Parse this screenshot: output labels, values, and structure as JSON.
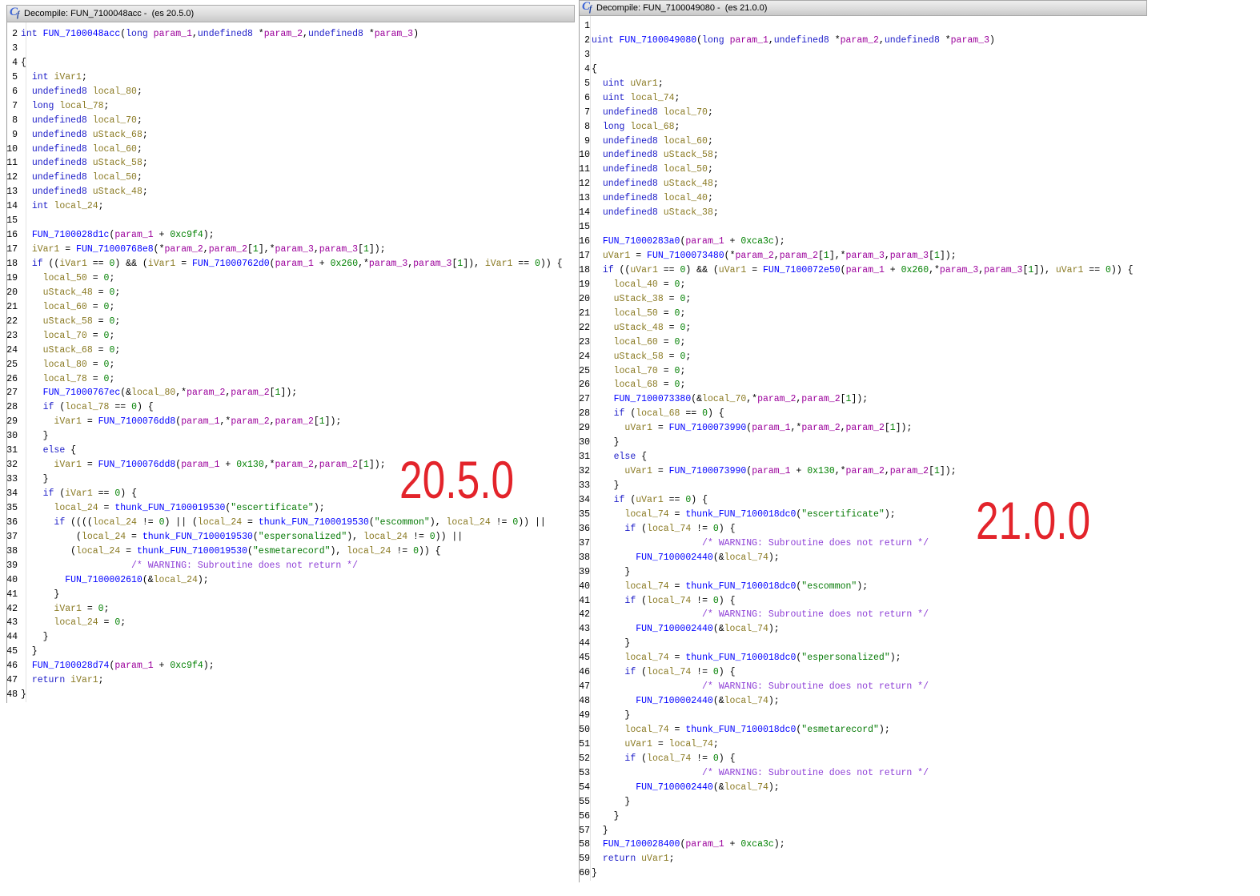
{
  "syntax_colors": {
    "keyword": "#1d1dc8",
    "function": "#0000ff",
    "parameter": "#9b009b",
    "variable": "#8a7a23",
    "constant": "#008000",
    "string": "#067a06",
    "comment": "#8e3fd6"
  },
  "annotation_color": "#e3242b",
  "annotations": [
    {
      "text": "20.5.0"
    },
    {
      "text": "21.0.0"
    }
  ],
  "windows": [
    {
      "icon": {
        "name": "decompiler-icon",
        "glyph": "C",
        "subscript": "f"
      },
      "title": "Decompile: FUN_7100048acc -  (es 20.5.0)",
      "lines": [
        {
          "n": 2,
          "code": "int FUN_7100048acc(long param_1,undefined8 *param_2,undefined8 *param_3)"
        },
        {
          "n": 3,
          "code": ""
        },
        {
          "n": 4,
          "code": "{"
        },
        {
          "n": 5,
          "code": "  int iVar1;"
        },
        {
          "n": 6,
          "code": "  undefined8 local_80;"
        },
        {
          "n": 7,
          "code": "  long local_78;"
        },
        {
          "n": 8,
          "code": "  undefined8 local_70;"
        },
        {
          "n": 9,
          "code": "  undefined8 uStack_68;"
        },
        {
          "n": 10,
          "code": "  undefined8 local_60;"
        },
        {
          "n": 11,
          "code": "  undefined8 uStack_58;"
        },
        {
          "n": 12,
          "code": "  undefined8 local_50;"
        },
        {
          "n": 13,
          "code": "  undefined8 uStack_48;"
        },
        {
          "n": 14,
          "code": "  int local_24;"
        },
        {
          "n": 15,
          "code": ""
        },
        {
          "n": 16,
          "code": "  FUN_7100028d1c(param_1 + 0xc9f4);"
        },
        {
          "n": 17,
          "code": "  iVar1 = FUN_71000768e8(*param_2,param_2[1],*param_3,param_3[1]);"
        },
        {
          "n": 18,
          "code": "  if ((iVar1 == 0) && (iVar1 = FUN_71000762d0(param_1 + 0x260,*param_3,param_3[1]), iVar1 == 0)) {"
        },
        {
          "n": 19,
          "code": "    local_50 = 0;"
        },
        {
          "n": 20,
          "code": "    uStack_48 = 0;"
        },
        {
          "n": 21,
          "code": "    local_60 = 0;"
        },
        {
          "n": 22,
          "code": "    uStack_58 = 0;"
        },
        {
          "n": 23,
          "code": "    local_70 = 0;"
        },
        {
          "n": 24,
          "code": "    uStack_68 = 0;"
        },
        {
          "n": 25,
          "code": "    local_80 = 0;"
        },
        {
          "n": 26,
          "code": "    local_78 = 0;"
        },
        {
          "n": 27,
          "code": "    FUN_71000767ec(&local_80,*param_2,param_2[1]);"
        },
        {
          "n": 28,
          "code": "    if (local_78 == 0) {"
        },
        {
          "n": 29,
          "code": "      iVar1 = FUN_7100076dd8(param_1,*param_2,param_2[1]);"
        },
        {
          "n": 30,
          "code": "    }"
        },
        {
          "n": 31,
          "code": "    else {"
        },
        {
          "n": 32,
          "code": "      iVar1 = FUN_7100076dd8(param_1 + 0x130,*param_2,param_2[1]);"
        },
        {
          "n": 33,
          "code": "    }"
        },
        {
          "n": 34,
          "code": "    if (iVar1 == 0) {"
        },
        {
          "n": 35,
          "code": "      local_24 = thunk_FUN_7100019530(\"escertificate\");"
        },
        {
          "n": 36,
          "code": "      if ((((local_24 != 0) || (local_24 = thunk_FUN_7100019530(\"escommon\"), local_24 != 0)) ||"
        },
        {
          "n": 37,
          "code": "          (local_24 = thunk_FUN_7100019530(\"espersonalized\"), local_24 != 0)) ||"
        },
        {
          "n": 38,
          "code": "         (local_24 = thunk_FUN_7100019530(\"esmetarecord\"), local_24 != 0)) {"
        },
        {
          "n": 39,
          "code": "                    /* WARNING: Subroutine does not return */"
        },
        {
          "n": 40,
          "code": "        FUN_7100002610(&local_24);"
        },
        {
          "n": 41,
          "code": "      }"
        },
        {
          "n": 42,
          "code": "      iVar1 = 0;"
        },
        {
          "n": 43,
          "code": "      local_24 = 0;"
        },
        {
          "n": 44,
          "code": "    }"
        },
        {
          "n": 45,
          "code": "  }"
        },
        {
          "n": 46,
          "code": "  FUN_7100028d74(param_1 + 0xc9f4);"
        },
        {
          "n": 47,
          "code": "  return iVar1;"
        },
        {
          "n": 48,
          "code": "}"
        }
      ]
    },
    {
      "icon": {
        "name": "decompiler-icon",
        "glyph": "C",
        "subscript": "f"
      },
      "title": "Decompile: FUN_7100049080 -  (es 21.0.0)",
      "lines": [
        {
          "n": 1,
          "code": ""
        },
        {
          "n": 2,
          "code": "uint FUN_7100049080(long param_1,undefined8 *param_2,undefined8 *param_3)"
        },
        {
          "n": 3,
          "code": ""
        },
        {
          "n": 4,
          "code": "{"
        },
        {
          "n": 5,
          "code": "  uint uVar1;"
        },
        {
          "n": 6,
          "code": "  uint local_74;"
        },
        {
          "n": 7,
          "code": "  undefined8 local_70;"
        },
        {
          "n": 8,
          "code": "  long local_68;"
        },
        {
          "n": 9,
          "code": "  undefined8 local_60;"
        },
        {
          "n": 10,
          "code": "  undefined8 uStack_58;"
        },
        {
          "n": 11,
          "code": "  undefined8 local_50;"
        },
        {
          "n": 12,
          "code": "  undefined8 uStack_48;"
        },
        {
          "n": 13,
          "code": "  undefined8 local_40;"
        },
        {
          "n": 14,
          "code": "  undefined8 uStack_38;"
        },
        {
          "n": 15,
          "code": ""
        },
        {
          "n": 16,
          "code": "  FUN_71000283a0(param_1 + 0xca3c);"
        },
        {
          "n": 17,
          "code": "  uVar1 = FUN_7100073480(*param_2,param_2[1],*param_3,param_3[1]);"
        },
        {
          "n": 18,
          "code": "  if ((uVar1 == 0) && (uVar1 = FUN_7100072e50(param_1 + 0x260,*param_3,param_3[1]), uVar1 == 0)) {"
        },
        {
          "n": 19,
          "code": "    local_40 = 0;"
        },
        {
          "n": 20,
          "code": "    uStack_38 = 0;"
        },
        {
          "n": 21,
          "code": "    local_50 = 0;"
        },
        {
          "n": 22,
          "code": "    uStack_48 = 0;"
        },
        {
          "n": 23,
          "code": "    local_60 = 0;"
        },
        {
          "n": 24,
          "code": "    uStack_58 = 0;"
        },
        {
          "n": 25,
          "code": "    local_70 = 0;"
        },
        {
          "n": 26,
          "code": "    local_68 = 0;"
        },
        {
          "n": 27,
          "code": "    FUN_7100073380(&local_70,*param_2,param_2[1]);"
        },
        {
          "n": 28,
          "code": "    if (local_68 == 0) {"
        },
        {
          "n": 29,
          "code": "      uVar1 = FUN_7100073990(param_1,*param_2,param_2[1]);"
        },
        {
          "n": 30,
          "code": "    }"
        },
        {
          "n": 31,
          "code": "    else {"
        },
        {
          "n": 32,
          "code": "      uVar1 = FUN_7100073990(param_1 + 0x130,*param_2,param_2[1]);"
        },
        {
          "n": 33,
          "code": "    }"
        },
        {
          "n": 34,
          "code": "    if (uVar1 == 0) {"
        },
        {
          "n": 35,
          "code": "      local_74 = thunk_FUN_7100018dc0(\"escertificate\");"
        },
        {
          "n": 36,
          "code": "      if (local_74 != 0) {"
        },
        {
          "n": 37,
          "code": "                    /* WARNING: Subroutine does not return */"
        },
        {
          "n": 38,
          "code": "        FUN_7100002440(&local_74);"
        },
        {
          "n": 39,
          "code": "      }"
        },
        {
          "n": 40,
          "code": "      local_74 = thunk_FUN_7100018dc0(\"escommon\");"
        },
        {
          "n": 41,
          "code": "      if (local_74 != 0) {"
        },
        {
          "n": 42,
          "code": "                    /* WARNING: Subroutine does not return */"
        },
        {
          "n": 43,
          "code": "        FUN_7100002440(&local_74);"
        },
        {
          "n": 44,
          "code": "      }"
        },
        {
          "n": 45,
          "code": "      local_74 = thunk_FUN_7100018dc0(\"espersonalized\");"
        },
        {
          "n": 46,
          "code": "      if (local_74 != 0) {"
        },
        {
          "n": 47,
          "code": "                    /* WARNING: Subroutine does not return */"
        },
        {
          "n": 48,
          "code": "        FUN_7100002440(&local_74);"
        },
        {
          "n": 49,
          "code": "      }"
        },
        {
          "n": 50,
          "code": "      local_74 = thunk_FUN_7100018dc0(\"esmetarecord\");"
        },
        {
          "n": 51,
          "code": "      uVar1 = local_74;"
        },
        {
          "n": 52,
          "code": "      if (local_74 != 0) {"
        },
        {
          "n": 53,
          "code": "                    /* WARNING: Subroutine does not return */"
        },
        {
          "n": 54,
          "code": "        FUN_7100002440(&local_74);"
        },
        {
          "n": 55,
          "code": "      }"
        },
        {
          "n": 56,
          "code": "    }"
        },
        {
          "n": 57,
          "code": "  }"
        },
        {
          "n": 58,
          "code": "  FUN_7100028400(param_1 + 0xca3c);"
        },
        {
          "n": 59,
          "code": "  return uVar1;"
        },
        {
          "n": 60,
          "code": "}"
        }
      ]
    }
  ]
}
